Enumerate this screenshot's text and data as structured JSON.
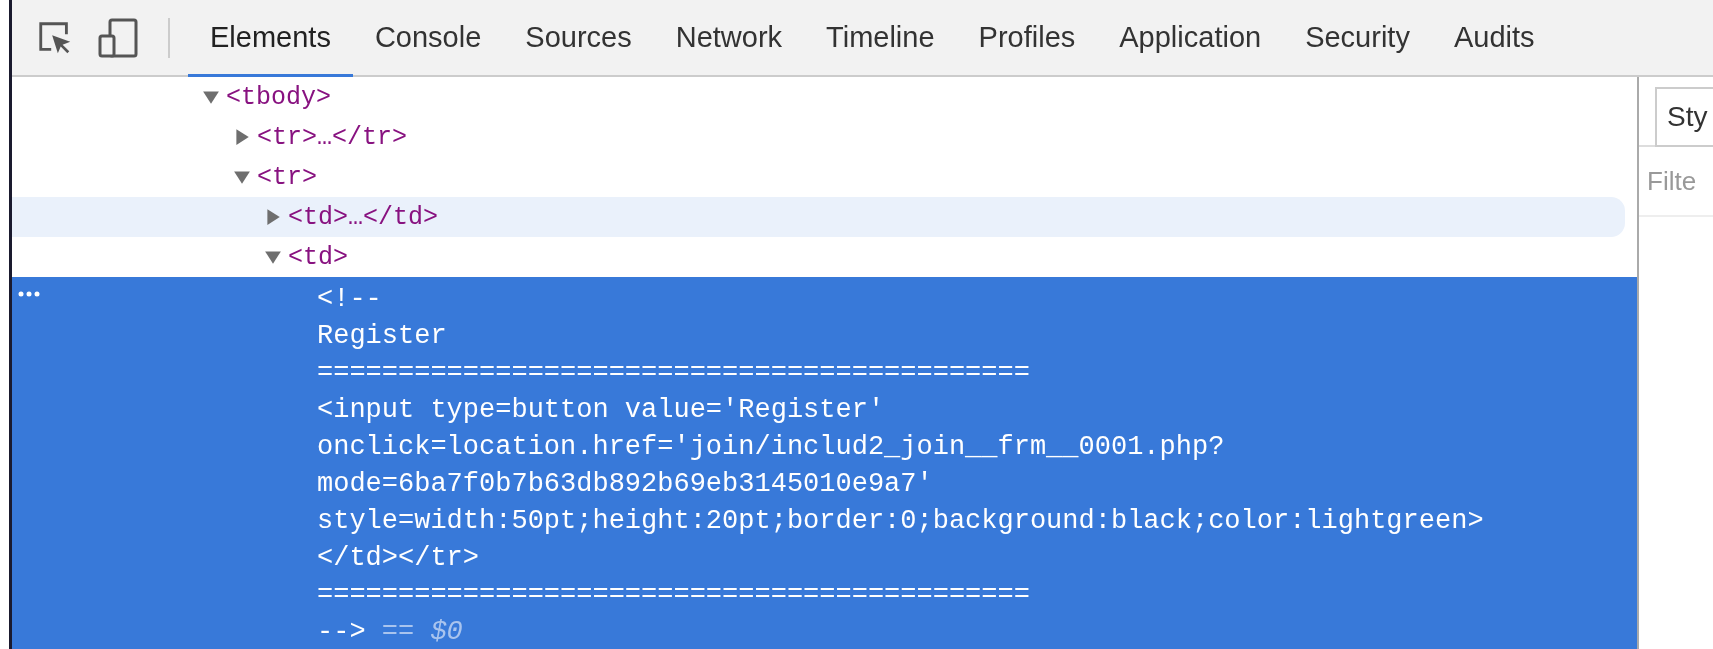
{
  "tabs": [
    {
      "label": "Elements",
      "selected": true
    },
    {
      "label": "Console",
      "selected": false
    },
    {
      "label": "Sources",
      "selected": false
    },
    {
      "label": "Network",
      "selected": false
    },
    {
      "label": "Timeline",
      "selected": false
    },
    {
      "label": "Profiles",
      "selected": false
    },
    {
      "label": "Application",
      "selected": false
    },
    {
      "label": "Security",
      "selected": false
    },
    {
      "label": "Audits",
      "selected": false
    }
  ],
  "tree": [
    {
      "kind": "tag",
      "text": "<tbody>",
      "expanded": true,
      "hovered": false,
      "children": [
        {
          "kind": "tag",
          "text": "<tr>…</tr>",
          "expanded": false,
          "hovered": false
        },
        {
          "kind": "tag",
          "text": "<tr>",
          "expanded": true,
          "hovered": false,
          "children": [
            {
              "kind": "tag",
              "text": "<td>…</td>",
              "expanded": false,
              "hovered": true
            },
            {
              "kind": "tag",
              "text": "<td>",
              "expanded": true,
              "hovered": false,
              "children": [
                {
                  "kind": "comment",
                  "selected": true,
                  "lines": [
                    "<!--",
                    "Register",
                    "============================================",
                    "<input type=button value='Register'",
                    "onclick=location.href='join/includ2_join__frm__0001.php?",
                    "mode=6ba7f0b7b63db892b69eb3145010e9a7'",
                    "style=width:50pt;height:20pt;border:0;background:black;color:lightgreen>",
                    "</td></tr>",
                    "============================================",
                    "-->"
                  ],
                  "marker": "== $0"
                }
              ]
            }
          ]
        }
      ]
    }
  ],
  "sidebar": {
    "tab": "Sty",
    "filter": {
      "placeholder": "Filte"
    }
  }
}
